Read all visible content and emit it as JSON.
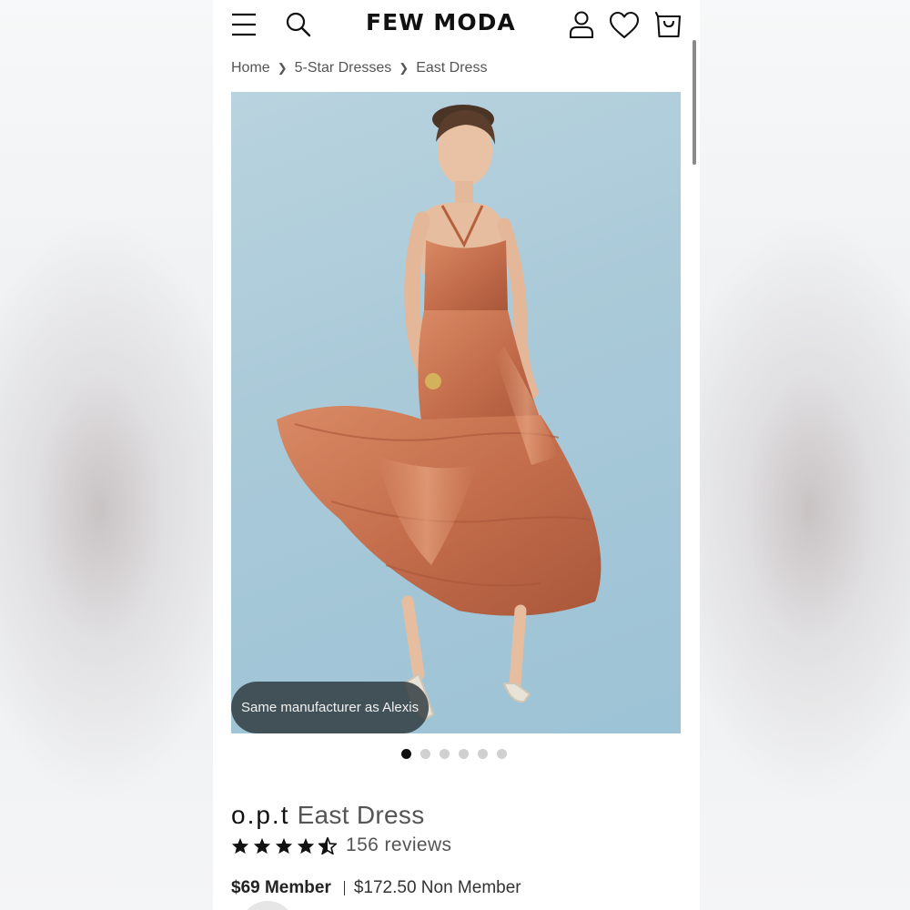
{
  "header": {
    "logo": "FEW MODA",
    "icons": [
      "menu-icon",
      "search-icon",
      "account-icon",
      "heart-icon",
      "bag-icon"
    ]
  },
  "breadcrumb": {
    "items": [
      "Home",
      "5-Star Dresses",
      "East Dress"
    ]
  },
  "gallery": {
    "badge": "Same manufacturer as Alexis",
    "image_count": 6,
    "active_index": 0
  },
  "product": {
    "brand": "o.p.t",
    "name": "East Dress",
    "rating": 4.5,
    "reviews": "156 reviews"
  },
  "price": {
    "member": "$69 Member",
    "non_member": "$172.50 Non Member"
  },
  "colors": {
    "text": "#111111",
    "dot_active": "#111111",
    "dot_inactive": "#d0d0d0",
    "hero_background": "#a9c9d8",
    "dress": "#c46e4c"
  }
}
